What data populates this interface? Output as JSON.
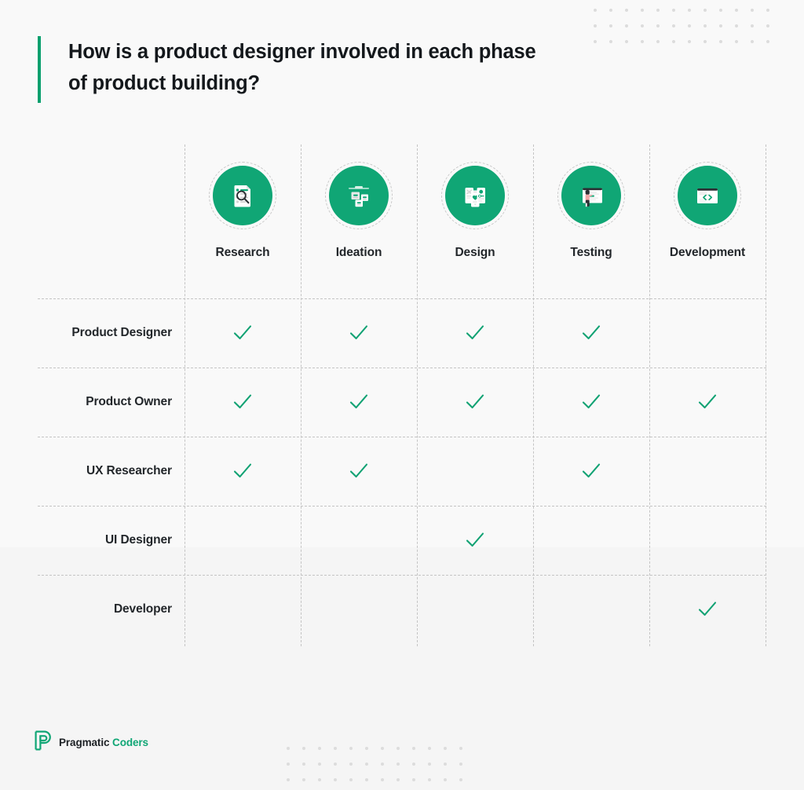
{
  "page": {
    "background_top": "#f9f9f9",
    "background_bottom": "#f5f5f5",
    "accent_color": "#10a675",
    "text_color": "#22262a"
  },
  "header": {
    "title": "How is a product designer involved in each phase of product building?",
    "accent_bar_color": "#0aa06e"
  },
  "matrix": {
    "columns": [
      {
        "label": "Research",
        "icon": "document-magnifier-icon"
      },
      {
        "label": "Ideation",
        "icon": "sticky-notes-board-icon"
      },
      {
        "label": "Design",
        "icon": "mobile-wireframes-icon"
      },
      {
        "label": "Testing",
        "icon": "presenter-whiteboard-icon"
      },
      {
        "label": "Development",
        "icon": "code-window-icon"
      }
    ],
    "rows": [
      {
        "label": "Product Designer",
        "checks": [
          true,
          true,
          true,
          true,
          false
        ]
      },
      {
        "label": "Product Owner",
        "checks": [
          true,
          true,
          true,
          true,
          true
        ]
      },
      {
        "label": "UX Researcher",
        "checks": [
          true,
          true,
          false,
          true,
          false
        ]
      },
      {
        "label": "UI Designer",
        "checks": [
          false,
          false,
          true,
          false,
          false
        ]
      },
      {
        "label": "Developer",
        "checks": [
          false,
          false,
          false,
          false,
          true
        ]
      }
    ],
    "check_color": "#11a273"
  },
  "footer": {
    "logo_mark": "pragmatic-coders-p-mark",
    "brand_first": "Pragmatic",
    "brand_second": "Coders"
  },
  "decoration": {
    "dot_grid_color": "#dcdcdc",
    "dot_grid_columns": 12,
    "dot_grid_rows": 3
  }
}
